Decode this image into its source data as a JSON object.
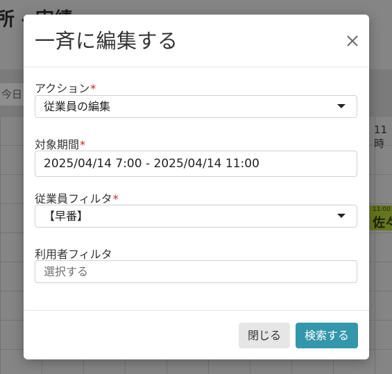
{
  "background": {
    "page_title": "所 - 実績",
    "today_button": "今日",
    "hour_label": "11時",
    "event": {
      "time": "11:00",
      "name": "佐々"
    }
  },
  "modal": {
    "title": "一斉に編集する",
    "fields": {
      "action": {
        "label": "アクション",
        "required_mark": "*",
        "value": "従業員の編集"
      },
      "period": {
        "label": "対象期間",
        "required_mark": "*",
        "value": "2025/04/14 7:00 - 2025/04/14 11:00"
      },
      "employee_filter": {
        "label": "従業員フィルタ",
        "required_mark": "*",
        "value": "【早番】"
      },
      "user_filter": {
        "label": "利用者フィルタ",
        "placeholder": "選択する"
      }
    },
    "buttons": {
      "close": "閉じる",
      "search": "検索する"
    }
  },
  "colors": {
    "primary": "#3396ab",
    "required": "#cc1e1e"
  }
}
